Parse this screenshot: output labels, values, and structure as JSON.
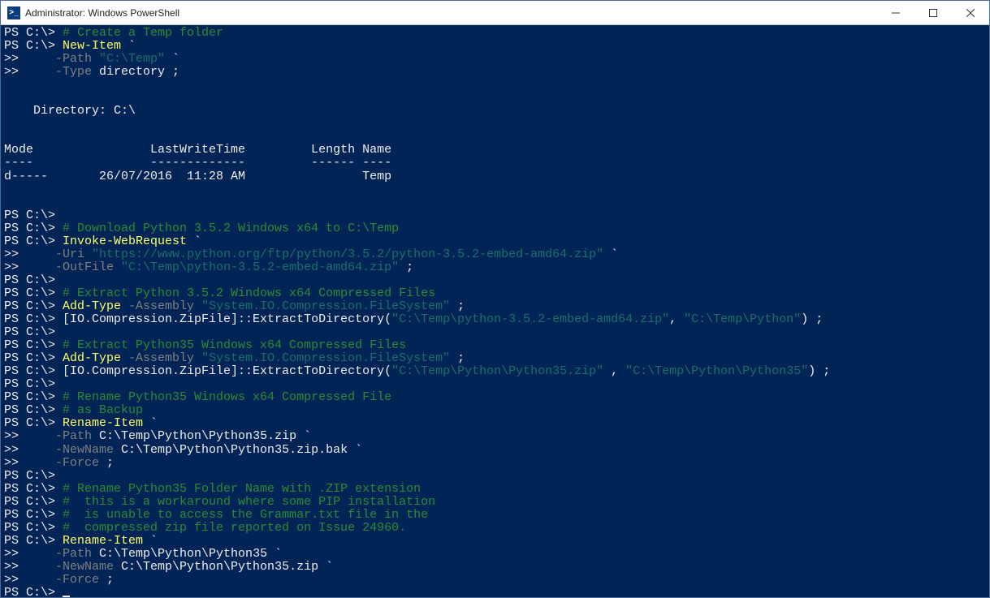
{
  "titlebar": {
    "icon_glyph": ">_",
    "title": "Administrator: Windows PowerShell",
    "minimize": "–",
    "maximize": "☐",
    "close": "✕"
  },
  "colors": {
    "bg": "#012456",
    "fg": "#eeedf0",
    "comment": "#2e8b32",
    "cmdlet": "#ffff66",
    "param": "#808080",
    "string": "#1b6f6a"
  },
  "dir_listing": {
    "heading": "    Directory: C:\\",
    "header": "Mode                LastWriteTime         Length Name",
    "underline": "----                -------------         ------ ----",
    "row": "d-----       26/07/2016  11:28 AM                Temp"
  },
  "lines": [
    {
      "p": "PS C:\\> ",
      "s": [
        {
          "c": "cmt",
          "t": "# Create a Temp folder"
        }
      ]
    },
    {
      "p": "PS C:\\> ",
      "s": [
        {
          "c": "cmd",
          "t": "New-Item"
        },
        {
          "c": "pr",
          "t": " `"
        }
      ]
    },
    {
      "p": ">>     ",
      "s": [
        {
          "c": "par",
          "t": "-Path"
        },
        {
          "c": "pr",
          "t": " "
        },
        {
          "c": "str",
          "t": "\"C:\\Temp\""
        },
        {
          "c": "pr",
          "t": " `"
        }
      ]
    },
    {
      "p": ">>     ",
      "s": [
        {
          "c": "par",
          "t": "-Type"
        },
        {
          "c": "pr",
          "t": " directory ;"
        }
      ]
    },
    {
      "p": "",
      "s": []
    },
    {
      "p": "",
      "s": []
    },
    {
      "raw": "dir_heading"
    },
    {
      "p": "",
      "s": []
    },
    {
      "p": "",
      "s": []
    },
    {
      "raw": "dir_header"
    },
    {
      "raw": "dir_underline"
    },
    {
      "raw": "dir_row"
    },
    {
      "p": "",
      "s": []
    },
    {
      "p": "",
      "s": []
    },
    {
      "p": "PS C:\\>",
      "s": []
    },
    {
      "p": "PS C:\\> ",
      "s": [
        {
          "c": "cmt",
          "t": "# Download Python 3.5.2 Windows x64 to C:\\Temp"
        }
      ]
    },
    {
      "p": "PS C:\\> ",
      "s": [
        {
          "c": "cmd",
          "t": "Invoke-WebRequest"
        },
        {
          "c": "pr",
          "t": " `"
        }
      ]
    },
    {
      "p": ">>     ",
      "s": [
        {
          "c": "par",
          "t": "-Uri"
        },
        {
          "c": "pr",
          "t": " "
        },
        {
          "c": "str",
          "t": "\"https://www.python.org/ftp/python/3.5.2/python-3.5.2-embed-amd64.zip\""
        },
        {
          "c": "pr",
          "t": " `"
        }
      ]
    },
    {
      "p": ">>     ",
      "s": [
        {
          "c": "par",
          "t": "-OutFile"
        },
        {
          "c": "pr",
          "t": " "
        },
        {
          "c": "str",
          "t": "\"C:\\Temp\\python-3.5.2-embed-amd64.zip\""
        },
        {
          "c": "pr",
          "t": " ;"
        }
      ]
    },
    {
      "p": "PS C:\\>",
      "s": []
    },
    {
      "p": "PS C:\\> ",
      "s": [
        {
          "c": "cmt",
          "t": "# Extract Python 3.5.2 Windows x64 Compressed Files"
        }
      ]
    },
    {
      "p": "PS C:\\> ",
      "s": [
        {
          "c": "cmd",
          "t": "Add-Type"
        },
        {
          "c": "pr",
          "t": " "
        },
        {
          "c": "par",
          "t": "-Assembly"
        },
        {
          "c": "pr",
          "t": " "
        },
        {
          "c": "str",
          "t": "\"System.IO.Compression.FileSystem\""
        },
        {
          "c": "pr",
          "t": " ;"
        }
      ]
    },
    {
      "p": "PS C:\\> ",
      "s": [
        {
          "c": "pr",
          "t": "[IO.Compression.ZipFile]::ExtractToDirectory("
        },
        {
          "c": "str",
          "t": "\"C:\\Temp\\python-3.5.2-embed-amd64.zip\""
        },
        {
          "c": "pr",
          "t": ", "
        },
        {
          "c": "str",
          "t": "\"C:\\Temp\\Python\""
        },
        {
          "c": "pr",
          "t": ") ;"
        }
      ]
    },
    {
      "p": "PS C:\\>",
      "s": []
    },
    {
      "p": "PS C:\\> ",
      "s": [
        {
          "c": "cmt",
          "t": "# Extract Python35 Windows x64 Compressed Files"
        }
      ]
    },
    {
      "p": "PS C:\\> ",
      "s": [
        {
          "c": "cmd",
          "t": "Add-Type"
        },
        {
          "c": "pr",
          "t": " "
        },
        {
          "c": "par",
          "t": "-Assembly"
        },
        {
          "c": "pr",
          "t": " "
        },
        {
          "c": "str",
          "t": "\"System.IO.Compression.FileSystem\""
        },
        {
          "c": "pr",
          "t": " ;"
        }
      ]
    },
    {
      "p": "PS C:\\> ",
      "s": [
        {
          "c": "pr",
          "t": "[IO.Compression.ZipFile]::ExtractToDirectory("
        },
        {
          "c": "str",
          "t": "\"C:\\Temp\\Python\\Python35.zip\""
        },
        {
          "c": "pr",
          "t": " , "
        },
        {
          "c": "str",
          "t": "\"C:\\Temp\\Python\\Python35\""
        },
        {
          "c": "pr",
          "t": ") ;"
        }
      ]
    },
    {
      "p": "PS C:\\>",
      "s": []
    },
    {
      "p": "PS C:\\> ",
      "s": [
        {
          "c": "cmt",
          "t": "# Rename Python35 Windows x64 Compressed File"
        }
      ]
    },
    {
      "p": "PS C:\\> ",
      "s": [
        {
          "c": "cmt",
          "t": "# as Backup"
        }
      ]
    },
    {
      "p": "PS C:\\> ",
      "s": [
        {
          "c": "cmd",
          "t": "Rename-Item"
        },
        {
          "c": "pr",
          "t": " `"
        }
      ]
    },
    {
      "p": ">>     ",
      "s": [
        {
          "c": "par",
          "t": "-Path"
        },
        {
          "c": "pr",
          "t": " C:\\Temp\\Python\\Python35.zip `"
        }
      ]
    },
    {
      "p": ">>     ",
      "s": [
        {
          "c": "par",
          "t": "-NewName"
        },
        {
          "c": "pr",
          "t": " C:\\Temp\\Python\\Python35.zip.bak `"
        }
      ]
    },
    {
      "p": ">>     ",
      "s": [
        {
          "c": "par",
          "t": "-Force"
        },
        {
          "c": "pr",
          "t": " ;"
        }
      ]
    },
    {
      "p": "PS C:\\>",
      "s": []
    },
    {
      "p": "PS C:\\> ",
      "s": [
        {
          "c": "cmt",
          "t": "# Rename Python35 Folder Name with .ZIP extension"
        }
      ]
    },
    {
      "p": "PS C:\\> ",
      "s": [
        {
          "c": "cmt",
          "t": "#  this is a workaround where some PIP installation"
        }
      ]
    },
    {
      "p": "PS C:\\> ",
      "s": [
        {
          "c": "cmt",
          "t": "#  is unable to access the Grammar.txt file in the"
        }
      ]
    },
    {
      "p": "PS C:\\> ",
      "s": [
        {
          "c": "cmt",
          "t": "#  compressed zip file reported on Issue 24960."
        }
      ]
    },
    {
      "p": "PS C:\\> ",
      "s": [
        {
          "c": "cmd",
          "t": "Rename-Item"
        },
        {
          "c": "pr",
          "t": " `"
        }
      ]
    },
    {
      "p": ">>     ",
      "s": [
        {
          "c": "par",
          "t": "-Path"
        },
        {
          "c": "pr",
          "t": " C:\\Temp\\Python\\Python35 `"
        }
      ]
    },
    {
      "p": ">>     ",
      "s": [
        {
          "c": "par",
          "t": "-NewName"
        },
        {
          "c": "pr",
          "t": " C:\\Temp\\Python\\Python35.zip `"
        }
      ]
    },
    {
      "p": ">>     ",
      "s": [
        {
          "c": "par",
          "t": "-Force"
        },
        {
          "c": "pr",
          "t": " ;"
        }
      ]
    },
    {
      "p": "PS C:\\> ",
      "s": [],
      "cursor": true
    }
  ]
}
